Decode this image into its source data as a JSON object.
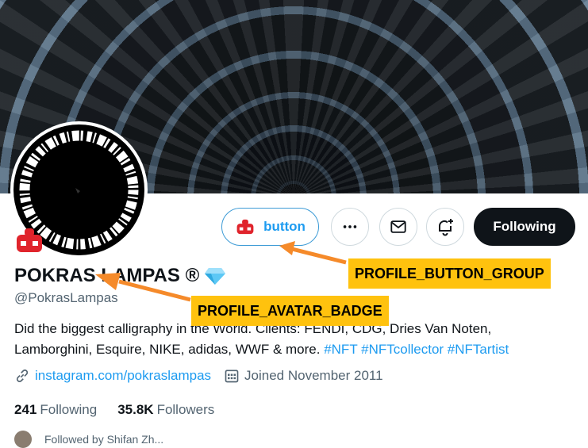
{
  "banner": {
    "description_icon": "calligraphy-banner"
  },
  "profile": {
    "name": "POKRAS LAMPAS ®",
    "verified_icon": "diamond-icon",
    "handle": "@PokrasLampas",
    "bio_text": "Did the biggest calligraphy in the World. Clients: FENDI, CDG, Dries Van Noten, Lamborghini, Esquire, NIKE, adidas, WWF & more. ",
    "bio_tags": [
      "#NFT",
      "#NFTcollector",
      "#NFTartist"
    ],
    "website": "instagram.com/pokraslampas",
    "joined": "Joined November 2011",
    "following_count": "241",
    "following_label": "Following",
    "followers_count": "35.8K",
    "followers_label": "Followers",
    "followed_by": "Followed by Shifan Zh..."
  },
  "buttons": {
    "custom_label": "button",
    "following_label": "Following"
  },
  "annotations": {
    "group_label": "PROFILE_BUTTON_GROUP",
    "badge_label": "PROFILE_AVATAR_BADGE"
  },
  "colors": {
    "accent": "#1d9bf0",
    "callout": "#ffc20e",
    "arrow": "#f58a2a",
    "badge_red": "#e0242c"
  }
}
